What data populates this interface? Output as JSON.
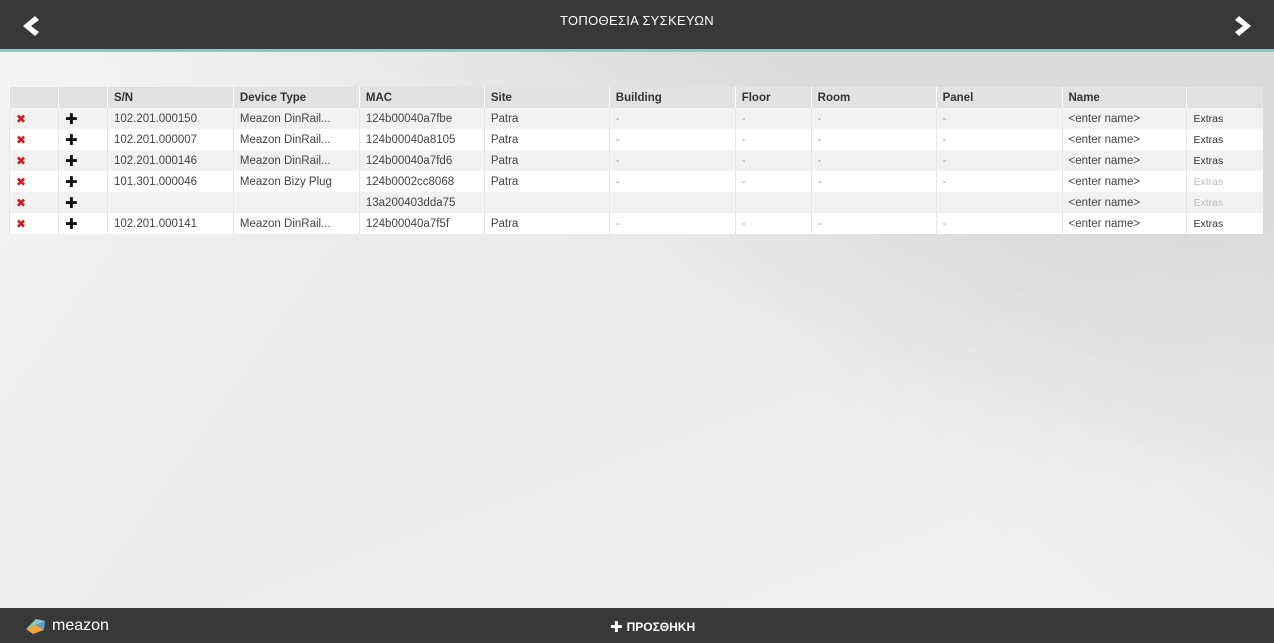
{
  "header": {
    "title": "ΤΟΠΟΘΕΣΙΑ ΣΥΣΚΕΥΩΝ",
    "back_icon": "chevron-left-icon",
    "forward_icon": "chevron-right-icon"
  },
  "table": {
    "columns": [
      "",
      "",
      "S/N",
      "Device Type",
      "MAC",
      "Site",
      "Building",
      "Floor",
      "Room",
      "Panel",
      "Name",
      ""
    ],
    "rows": [
      {
        "sn": "102.201.000150",
        "type": "Meazon DinRail...",
        "mac": "124b00040a7fbe",
        "site": "Patra",
        "building": "-",
        "floor": "-",
        "room": "-",
        "panel": "-",
        "name": "<enter name>",
        "extras": "Extras",
        "extras_enabled": true
      },
      {
        "sn": "102.201.000007",
        "type": "Meazon DinRail...",
        "mac": "124b00040a8105",
        "site": "Patra",
        "building": "-",
        "floor": "-",
        "room": "-",
        "panel": "-",
        "name": "<enter name>",
        "extras": "Extras",
        "extras_enabled": true
      },
      {
        "sn": "102.201.000146",
        "type": "Meazon DinRail...",
        "mac": "124b00040a7fd6",
        "site": "Patra",
        "building": "-",
        "floor": "-",
        "room": "-",
        "panel": "-",
        "name": "<enter name>",
        "extras": "Extras",
        "extras_enabled": true
      },
      {
        "sn": "101.301.000046",
        "type": "Meazon Bizy Plug",
        "mac": "124b0002cc8068",
        "site": "Patra",
        "building": "-",
        "floor": "-",
        "room": "-",
        "panel": "-",
        "name": "<enter name>",
        "extras": "Extras",
        "extras_enabled": false
      },
      {
        "sn": "",
        "type": "",
        "mac": "13a200403dda75",
        "site": "",
        "building": "",
        "floor": "",
        "room": "",
        "panel": "",
        "name": "<enter name>",
        "extras": "Extras",
        "extras_enabled": false
      },
      {
        "sn": "102.201.000141",
        "type": "Meazon DinRail...",
        "mac": "124b00040a7f5f",
        "site": "Patra",
        "building": "-",
        "floor": "-",
        "room": "-",
        "panel": "-",
        "name": "<enter name>",
        "extras": "Extras",
        "extras_enabled": true
      }
    ],
    "delete_glyph": "✖",
    "add_glyph": "✚"
  },
  "footer": {
    "logo_text": "meazon",
    "add_label": "ΠΡΟΣΘΗΚΗ",
    "add_glyph": "✚"
  },
  "colors": {
    "header_bg": "#383838",
    "accent": "#8fc9c3",
    "delete": "#d01b1b"
  }
}
